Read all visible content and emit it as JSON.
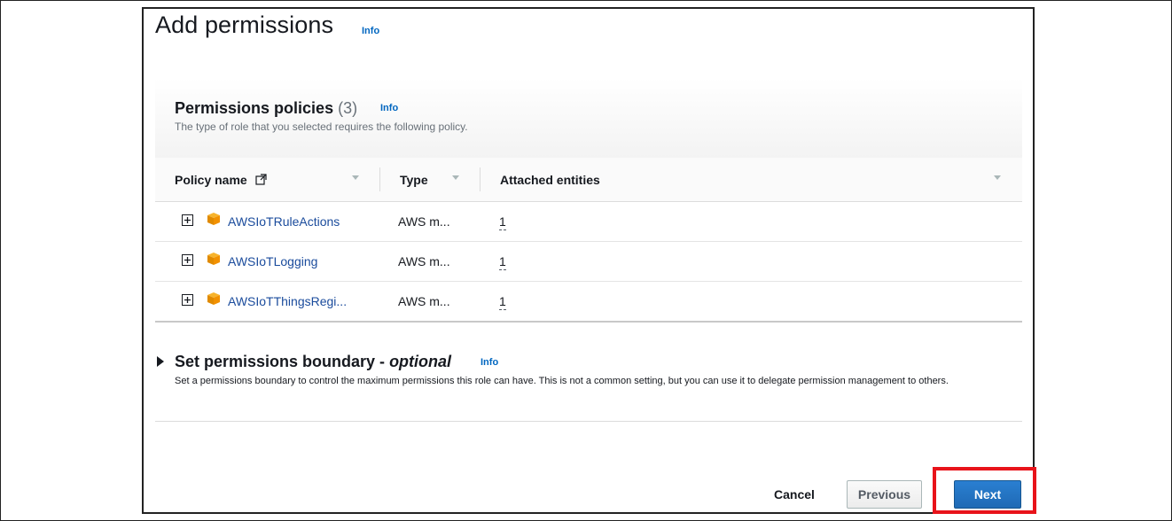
{
  "header": {
    "title": "Add permissions",
    "info": "Info"
  },
  "policies": {
    "title": "Permissions policies",
    "count": "(3)",
    "info": "Info",
    "description": "The type of role that you selected requires the following policy.",
    "columns": {
      "name": "Policy name",
      "type": "Type",
      "entities": "Attached entities"
    },
    "rows": [
      {
        "name": "AWSIoTRuleActions",
        "type": "AWS m...",
        "entities": "1"
      },
      {
        "name": "AWSIoTLogging",
        "type": "AWS m...",
        "entities": "1"
      },
      {
        "name": "AWSIoTThingsRegi...",
        "type": "AWS m...",
        "entities": "1"
      }
    ]
  },
  "boundary": {
    "title": "Set permissions boundary - ",
    "optional": "optional",
    "info": "Info",
    "description": "Set a permissions boundary to control the maximum permissions this role can have. This is not a common setting, but you can use it to delegate permission management to others."
  },
  "footer": {
    "cancel": "Cancel",
    "previous": "Previous",
    "next": "Next"
  },
  "colors": {
    "link": "#0066c0",
    "primary": "#1f6ab5",
    "highlight": "#e8131a",
    "policy_icon": "#f29100"
  }
}
